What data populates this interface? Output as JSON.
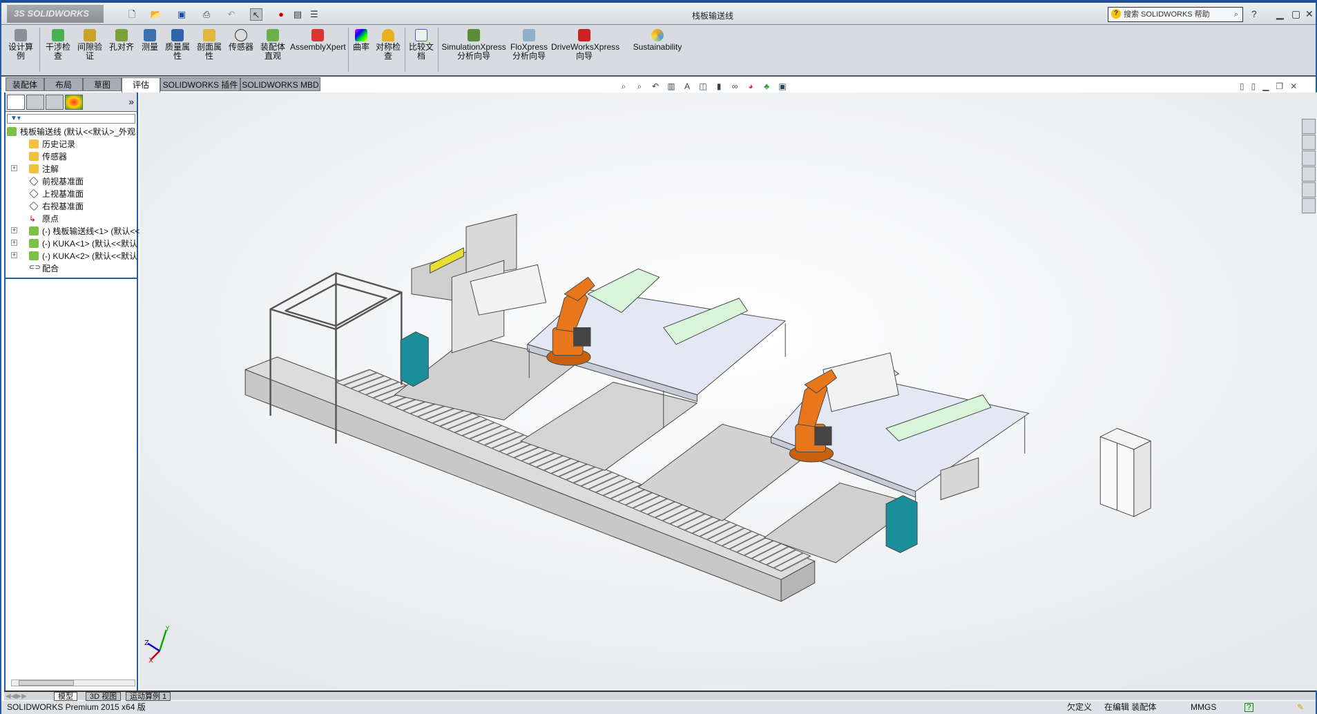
{
  "app": {
    "logo": "SOLIDWORKS",
    "document_title": "栈板输送线",
    "help_search_placeholder": "搜索 SOLIDWORKS 帮助"
  },
  "ribbon": {
    "items": [
      {
        "label": "设计算例"
      },
      {
        "label": "干涉检查"
      },
      {
        "label": "间隙验证"
      },
      {
        "label": "孔对齐"
      },
      {
        "label": "测量"
      },
      {
        "label": "质量属性"
      },
      {
        "label": "剖面属性"
      },
      {
        "label": "传感器"
      },
      {
        "label": "装配体直观"
      },
      {
        "label": "AssemblyXpert"
      },
      {
        "label": "曲率"
      },
      {
        "label": "对称检查"
      },
      {
        "label": "比较文档"
      },
      {
        "label": "SimulationXpress 分析向导"
      },
      {
        "label": "FloXpress 分析向导"
      },
      {
        "label": "DriveWorksXpress 向导"
      },
      {
        "label": "Sustainability"
      }
    ]
  },
  "tabs": [
    {
      "label": "装配体"
    },
    {
      "label": "布局"
    },
    {
      "label": "草图"
    },
    {
      "label": "评估",
      "active": true
    },
    {
      "label": "SOLIDWORKS 插件"
    },
    {
      "label": "SOLIDWORKS MBD"
    }
  ],
  "tree": {
    "root": "栈板输送线 (默认<<默认>_外观",
    "items": [
      {
        "label": "历史记录",
        "icon": "history-icon"
      },
      {
        "label": "传感器",
        "icon": "sensor-icon"
      },
      {
        "label": "注解",
        "icon": "annotation-icon",
        "expandable": true
      },
      {
        "label": "前视基准面",
        "icon": "plane-icon"
      },
      {
        "label": "上视基准面",
        "icon": "plane-icon"
      },
      {
        "label": "右视基准面",
        "icon": "plane-icon"
      },
      {
        "label": "原点",
        "icon": "origin-icon"
      },
      {
        "label": "(-) 栈板输送线<1> (默认<<",
        "icon": "assembly-icon",
        "expandable": true
      },
      {
        "label": "(-) KUKA<1> (默认<<默认",
        "icon": "assembly-icon",
        "expandable": true
      },
      {
        "label": "(-) KUKA<2> (默认<<默认",
        "icon": "assembly-icon",
        "expandable": true
      },
      {
        "label": "配合",
        "icon": "mates-icon"
      }
    ]
  },
  "bottom_tabs": [
    {
      "label": "模型",
      "active": true
    },
    {
      "label": "3D 视图"
    },
    {
      "label": "运动算例 1"
    }
  ],
  "status": {
    "product": "SOLIDWORKS Premium 2015 x64 版",
    "definition": "欠定义",
    "mode": "在编辑 装配体",
    "units": "MMGS"
  },
  "triad": {
    "x": "X",
    "y": "Y",
    "z": "Z"
  },
  "colors": {
    "robot": "#e8761a",
    "teal": "#1a8f9a",
    "platform": "#e4e8f4",
    "frame_blue": "#1f5da8"
  }
}
